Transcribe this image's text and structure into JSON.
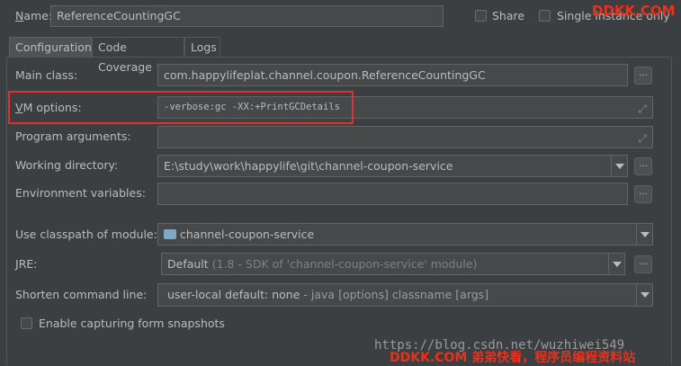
{
  "header": {
    "name_label": "Name:",
    "name_value": "ReferenceCountingGC",
    "share_label": "Share",
    "single_instance_label": "Single instance only"
  },
  "tabs": [
    {
      "label": "Configuration",
      "active": true
    },
    {
      "label": "Code Coverage",
      "active": false
    },
    {
      "label": "Logs",
      "active": false
    }
  ],
  "form": {
    "main_class_label": "Main class:",
    "main_class_value": "com.happylifeplat.channel.coupon.ReferenceCountingGC",
    "vm_options_label": "VM options:",
    "vm_options_value": "-verbose:gc -XX:+PrintGCDetails",
    "program_args_label": "Program arguments:",
    "program_args_value": "",
    "working_dir_label": "Working directory:",
    "working_dir_value": "E:\\study\\work\\happylife\\git\\channel-coupon-service",
    "env_vars_label": "Environment variables:",
    "env_vars_value": "",
    "classpath_label": "Use classpath of module:",
    "classpath_value": "channel-coupon-service",
    "jre_label": "JRE:",
    "jre_value": "Default",
    "jre_hint": "(1.8 - SDK of 'channel-coupon-service' module)",
    "shorten_label": "Shorten command line:",
    "shorten_value": "user-local default: none",
    "shorten_hint": "- java [options] classname [args]",
    "capture_label": "Enable capturing form snapshots",
    "dots_label": "..."
  },
  "watermarks": {
    "top_right": "DDKK.COM",
    "url": "https://blog.csdn.net/wuzhiwei549",
    "bottom": "DDKK.COM 弟弟快看，程序员编程资料站"
  },
  "colors": {
    "highlight_border": "#e03030",
    "background": "#3c3f41",
    "field_background": "#45494a"
  }
}
